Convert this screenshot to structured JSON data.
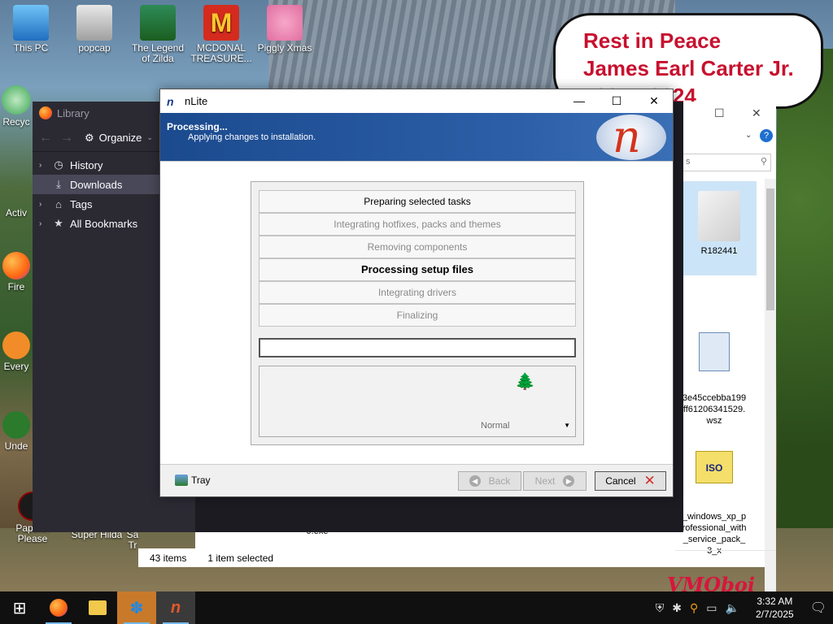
{
  "desktop": {
    "icons": [
      {
        "label": "This PC"
      },
      {
        "label": "popcap"
      },
      {
        "label": "The Legend of Zilda"
      },
      {
        "label": "MCDONAL TREASURE..."
      },
      {
        "label": "Piggly Xmas"
      },
      {
        "label": "Recyc"
      },
      {
        "label": "Activ"
      },
      {
        "label": "Fire"
      },
      {
        "label": "Every"
      },
      {
        "label": "Unde"
      },
      {
        "label": "Papers, Please"
      },
      {
        "label": "Super Hilda"
      },
      {
        "label": "Sa Tr"
      }
    ],
    "rip_note": {
      "line1": "Rest in Peace",
      "line2": "James Earl Carter Jr.",
      "line3": "1924 - 2024"
    },
    "watermark": "VMOboi"
  },
  "library": {
    "title": "Library",
    "organize_label": "Organize",
    "items": [
      {
        "label": "History",
        "icon": "clock-icon",
        "expandable": true,
        "selected": false
      },
      {
        "label": "Downloads",
        "icon": "download-icon",
        "expandable": false,
        "selected": true
      },
      {
        "label": "Tags",
        "icon": "tag-icon",
        "expandable": true,
        "selected": false
      },
      {
        "label": "All Bookmarks",
        "icon": "star-icon",
        "expandable": true,
        "selected": false
      }
    ]
  },
  "explorer": {
    "search_placeholder": "s",
    "files": [
      {
        "name": "R182441",
        "icon": "folder-icon"
      },
      {
        "name": "3e45ccebba199ff61206341529.wsz",
        "icon": "file-icon"
      },
      {
        "name": "_windows_xp_professional_with_service_pack_3_x",
        "icon": "iso-icon"
      }
    ],
    "bottom_files": [
      {
        "name": "0.exe"
      }
    ],
    "status": {
      "items_count": "43 items",
      "selected": "1 item selected"
    }
  },
  "nlite": {
    "title": "nLite",
    "header": {
      "title": "Processing...",
      "subtitle": "Applying changes to installation."
    },
    "steps": [
      {
        "label": "Preparing selected tasks",
        "state": "done"
      },
      {
        "label": "Integrating hotfixes, packs and themes",
        "state": "pending"
      },
      {
        "label": "Removing components",
        "state": "pending"
      },
      {
        "label": "Processing setup files",
        "state": "active"
      },
      {
        "label": "Integrating drivers",
        "state": "pending"
      },
      {
        "label": "Finalizing",
        "state": "pending"
      }
    ],
    "progress": 0,
    "priority_select": "Normal",
    "buttons": {
      "tray": "Tray",
      "back": "Back",
      "next": "Next",
      "cancel": "Cancel"
    }
  },
  "taskbar": {
    "time": "3:32 AM",
    "date": "2/7/2025",
    "apps": [
      {
        "name": "start-button",
        "glyph": "⊞"
      },
      {
        "name": "firefox-taskbar",
        "glyph": "●"
      },
      {
        "name": "file-explorer-taskbar",
        "glyph": "▤"
      },
      {
        "name": "msn-taskbar",
        "glyph": "✽"
      },
      {
        "name": "nlite-taskbar",
        "glyph": "n"
      }
    ]
  }
}
